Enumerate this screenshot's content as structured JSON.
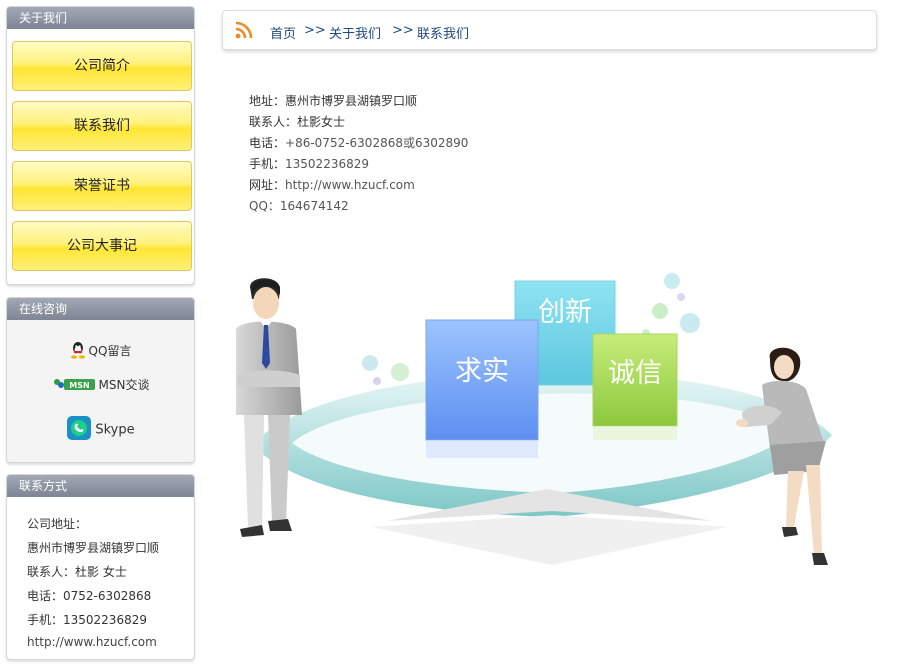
{
  "sidebar": {
    "about": {
      "title": "关于我们",
      "items": [
        {
          "label": "公司简介"
        },
        {
          "label": "联系我们"
        },
        {
          "label": "荣誉证书"
        },
        {
          "label": "公司大事记"
        }
      ]
    },
    "online": {
      "title": "在线咨询",
      "items": [
        {
          "label": "QQ留言",
          "icon": "qq-icon"
        },
        {
          "label": "MSN交谈",
          "icon": "msn-icon"
        },
        {
          "label": "Skype",
          "icon": "skype-icon"
        }
      ]
    },
    "contact": {
      "title": "联系方式",
      "lines": [
        "公司地址：",
        "惠州市博罗县湖镇罗口顺",
        "联系人：杜影 女士",
        "电话：0752-6302868",
        "手机：13502236829",
        "http://www.hzucf.com"
      ]
    }
  },
  "breadcrumb": {
    "items": [
      "首页",
      "关于我们",
      "联系我们"
    ],
    "separator": ">>"
  },
  "info": {
    "address_label": "地址：",
    "address": "惠州市博罗县湖镇罗口顺",
    "contact_label": "联系人：",
    "contact": "杜影女士",
    "phone_label": "电话：",
    "phone": "+86-0752-6302868或6302890",
    "mobile_label": "手机：",
    "mobile": "13502236829",
    "website_label": "网址：",
    "website": "http://www.hzucf.com",
    "qq_label": "QQ：",
    "qq": "164674142"
  },
  "illustration": {
    "blocks": [
      "求实",
      "创新",
      "诚信"
    ]
  },
  "colors": {
    "nav_yellow": "#ffe632",
    "panel_header": "#8a92a0",
    "link_blue": "#1f4a7f",
    "rss_orange": "#f08a24"
  }
}
